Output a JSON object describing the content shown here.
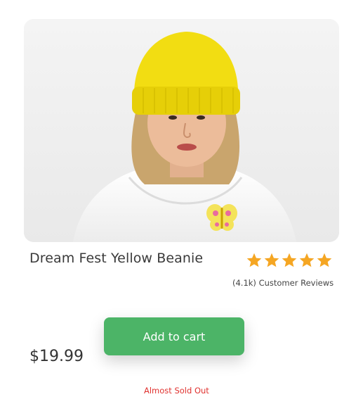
{
  "product": {
    "title": "Dream Fest Yellow Beanie",
    "price": "$19.99",
    "rating": 5,
    "rating_max": 5,
    "reviews_text": "(4.1k) Customer Reviews",
    "stock_status": "Almost Sold Out"
  },
  "actions": {
    "add_to_cart_label": "Add to cart"
  },
  "colors": {
    "accent": "#4cb467",
    "star": "#f5a623",
    "stock_warning": "#e0322f",
    "beanie": "#f2dd12"
  }
}
